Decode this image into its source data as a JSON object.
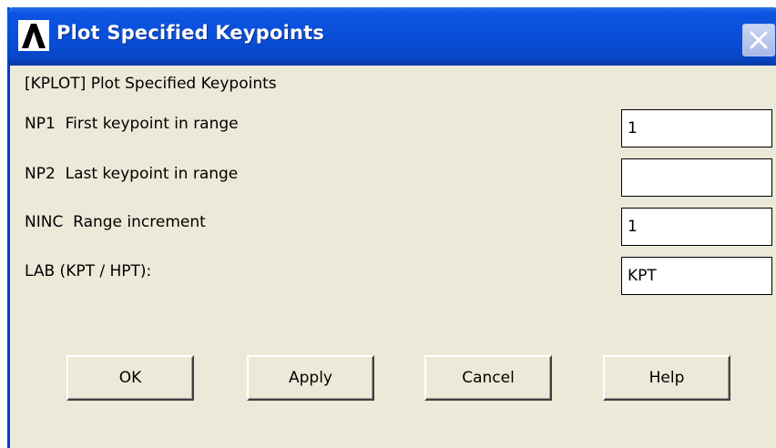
{
  "window": {
    "title": "Plot Specified Keypoints",
    "app_icon": "ansys-logo-icon",
    "close_icon": "close-icon"
  },
  "colors": {
    "titlebar": "#0a4fd9",
    "dialog_bg": "#ece9d8",
    "field_bg": "#ffffff"
  },
  "dialog": {
    "heading": "[KPLOT] Plot Specified Keypoints",
    "rows": [
      {
        "label": "NP1  First keypoint in range",
        "value": "1"
      },
      {
        "label": "NP2  Last keypoint in range",
        "value": ""
      },
      {
        "label": "NINC  Range increment",
        "value": "1"
      },
      {
        "label": "LAB (KPT / HPT):",
        "value": "KPT"
      }
    ]
  },
  "buttons": {
    "ok": "OK",
    "apply": "Apply",
    "cancel": "Cancel",
    "help": "Help"
  }
}
